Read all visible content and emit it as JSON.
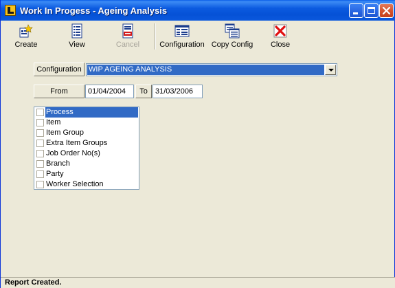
{
  "window": {
    "title": "Work In Progess - Ageing Analysis"
  },
  "toolbar": {
    "items": [
      {
        "label": "Create",
        "icon": "create-report-icon",
        "enabled": true
      },
      {
        "label": "View",
        "icon": "view-report-icon",
        "enabled": true
      },
      {
        "label": "Cancel",
        "icon": "stop-icon",
        "enabled": false
      },
      {
        "label": "Configuration",
        "icon": "configuration-icon",
        "enabled": true
      },
      {
        "label": "Copy Config",
        "icon": "copy-config-icon",
        "enabled": true
      },
      {
        "label": "Close",
        "icon": "close-red-x-icon",
        "enabled": true
      }
    ]
  },
  "configuration": {
    "label": "Configuration",
    "selected": "WIP AGEING ANALYSIS"
  },
  "dates": {
    "from_label": "From",
    "from_value": "01/04/2004",
    "to_label": "To",
    "to_value": "31/03/2006"
  },
  "selection_list": {
    "items": [
      {
        "label": "Process",
        "checked": false,
        "selected": true
      },
      {
        "label": "Item",
        "checked": false,
        "selected": false
      },
      {
        "label": "Item Group",
        "checked": false,
        "selected": false
      },
      {
        "label": "Extra Item Groups",
        "checked": false,
        "selected": false
      },
      {
        "label": "Job Order No(s)",
        "checked": false,
        "selected": false
      },
      {
        "label": "Branch",
        "checked": false,
        "selected": false
      },
      {
        "label": "Party",
        "checked": false,
        "selected": false
      },
      {
        "label": "Worker Selection",
        "checked": false,
        "selected": false
      }
    ]
  },
  "status": {
    "text": "Report Created."
  },
  "colors": {
    "titlebar": "#0551D6",
    "selection": "#316AC5",
    "window_bg": "#ECE9D8"
  }
}
